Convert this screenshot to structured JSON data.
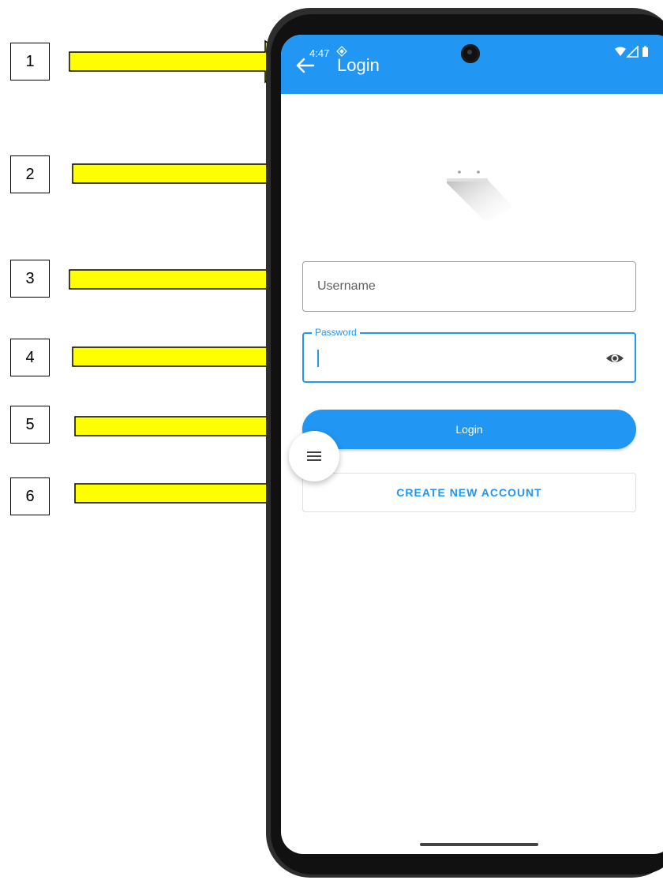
{
  "annotations": [
    {
      "number": "1"
    },
    {
      "number": "2"
    },
    {
      "number": "3"
    },
    {
      "number": "4"
    },
    {
      "number": "5"
    },
    {
      "number": "6"
    }
  ],
  "colors": {
    "arrow_fill": "#ffff00",
    "arrow_stroke": "#000000",
    "app_bar": "#2196f3",
    "accent": "#2196f3",
    "phone_frame": "#2e2e2e"
  },
  "status_bar": {
    "time": "4:47",
    "app_icon": "play-protect-icon",
    "icons": [
      "wifi-icon",
      "cell-signal-icon",
      "battery-icon"
    ]
  },
  "app_bar": {
    "title": "Login",
    "back_icon": "arrow-back-icon"
  },
  "logo": {
    "icon": "app-logo-icon"
  },
  "form": {
    "username": {
      "placeholder": "Username",
      "value": ""
    },
    "password": {
      "label": "Password",
      "value": "",
      "toggle_icon": "eye-icon"
    },
    "login_label": "Login",
    "create_account_label": "CREATE NEW ACCOUNT"
  },
  "fab": {
    "icon": "menu-icon"
  }
}
